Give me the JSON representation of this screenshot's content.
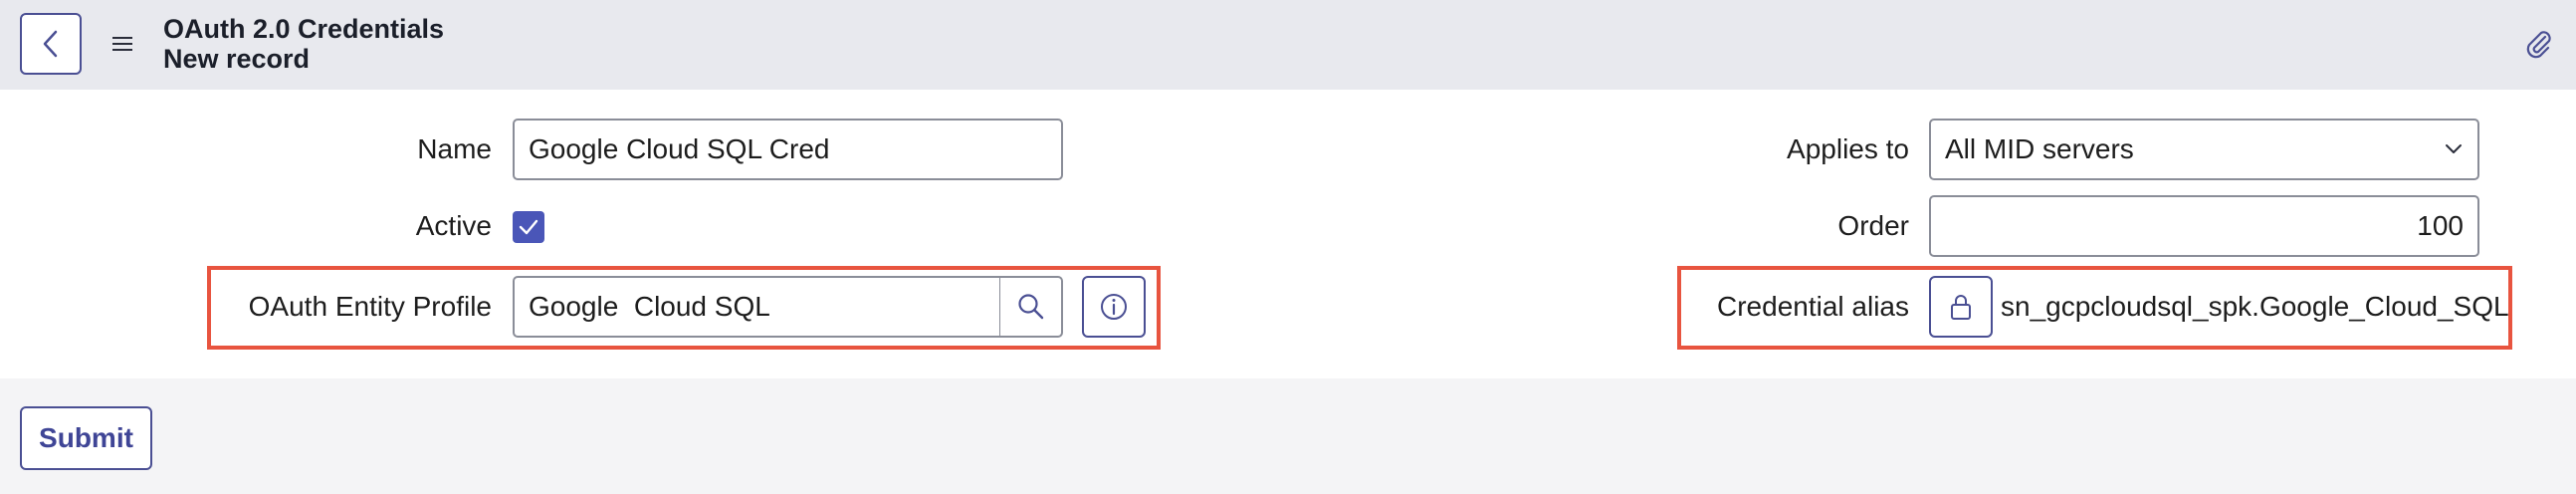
{
  "header": {
    "title": "OAuth 2.0 Credentials",
    "subtitle": "New record"
  },
  "form": {
    "name": {
      "label": "Name",
      "value": "Google Cloud SQL Cred"
    },
    "active": {
      "label": "Active",
      "checked": true
    },
    "oauth_entity_profile": {
      "label": "OAuth Entity Profile",
      "value": "Google  Cloud SQL"
    },
    "applies_to": {
      "label": "Applies to",
      "value": "All MID servers"
    },
    "order": {
      "label": "Order",
      "value": "100"
    },
    "credential_alias": {
      "label": "Credential alias",
      "value": "sn_gcpcloudsql_spk.Google_Cloud_SQL"
    }
  },
  "footer": {
    "submit_label": "Submit"
  },
  "colors": {
    "accent": "#4a56b8",
    "highlight": "#e8543f",
    "header_bg": "#e8e9ee"
  }
}
